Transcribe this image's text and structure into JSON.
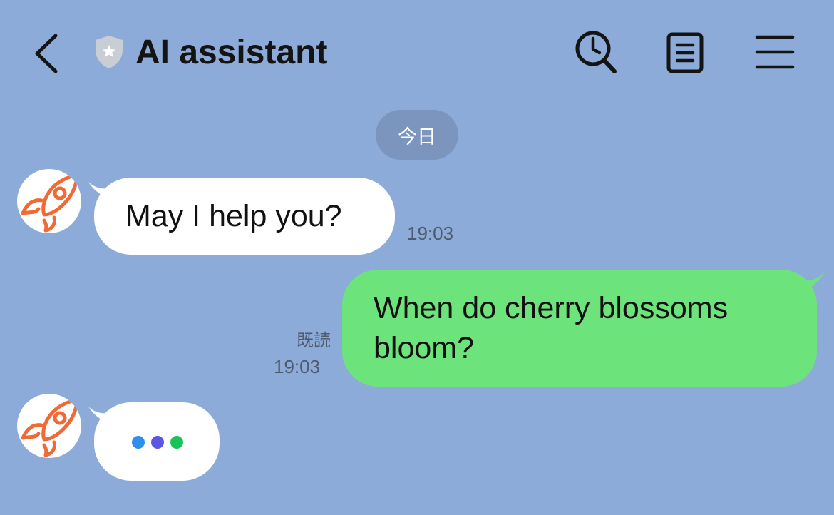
{
  "header": {
    "title": "AI assistant",
    "icons": [
      "chevron-left-icon",
      "shield-star-icon",
      "clock-search-icon",
      "notes-icon",
      "menu-icon"
    ]
  },
  "date_separator": "今日",
  "messages": [
    {
      "sender": "assistant",
      "text": "May I help you?",
      "time": "19:03"
    },
    {
      "sender": "user",
      "lines": [
        "When do cherry blossoms",
        "bloom?"
      ],
      "read_label": "既読",
      "time": "19:03"
    },
    {
      "sender": "assistant",
      "typing": true
    }
  ],
  "colors": {
    "background": "#8dabd9",
    "user_bubble": "#6de37b",
    "assistant_bubble": "#ffffff",
    "avatar_rocket": "#f06a35",
    "typing_dots": [
      "#2f8ff0",
      "#5c55e6",
      "#18c45a"
    ]
  }
}
